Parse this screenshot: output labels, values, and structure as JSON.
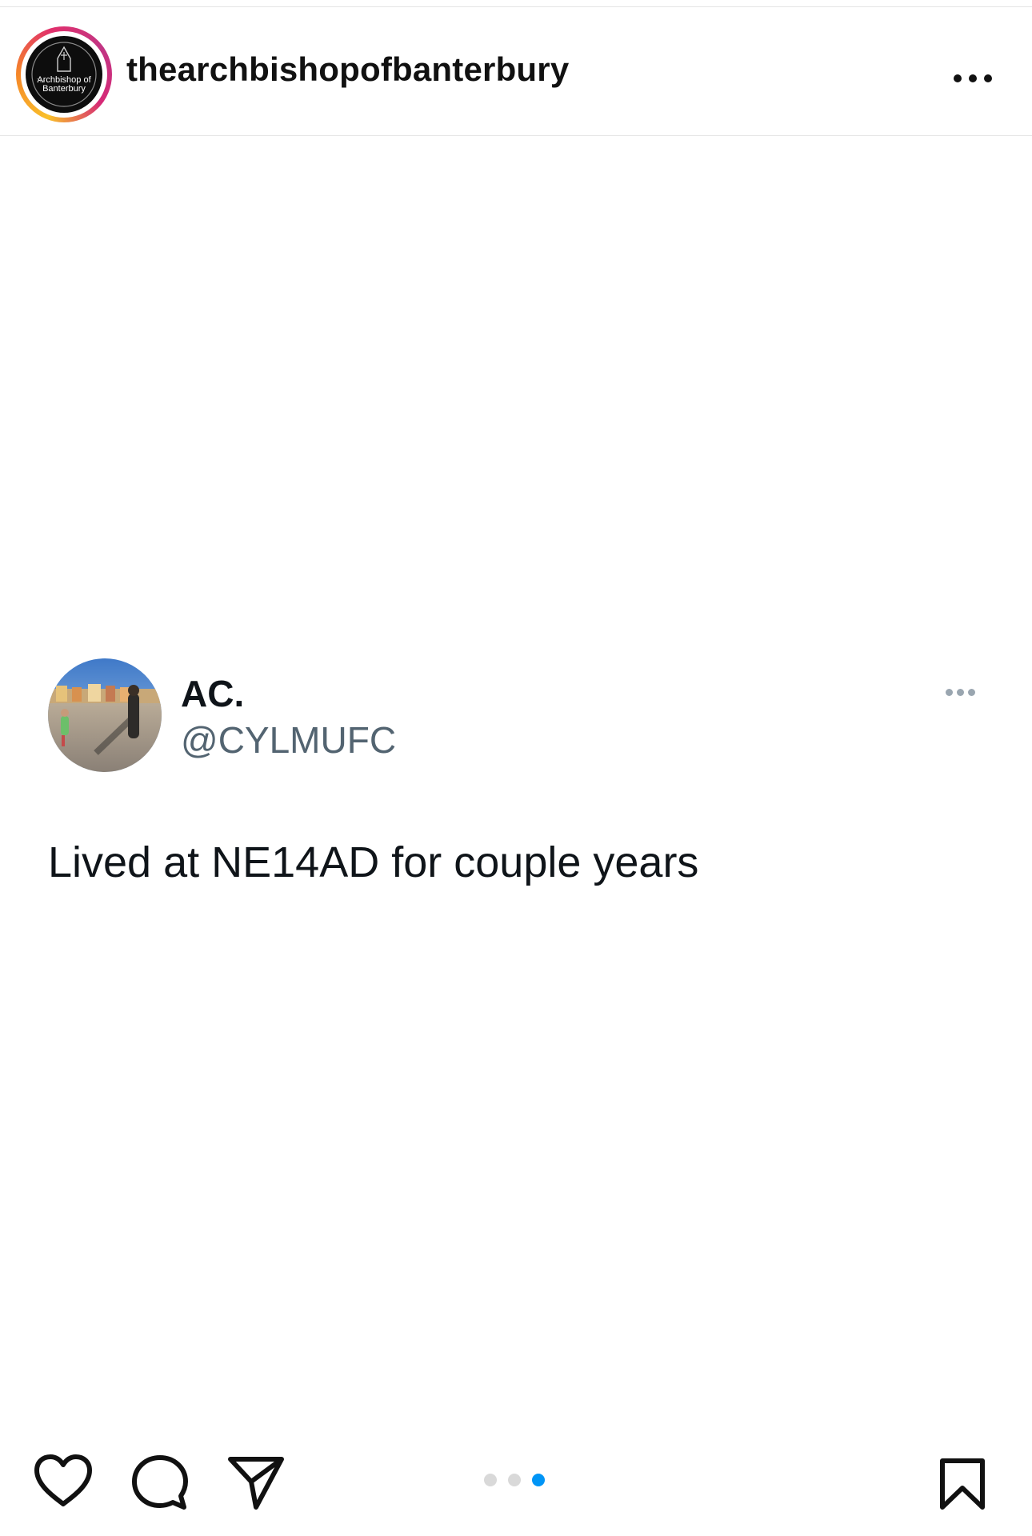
{
  "post": {
    "username": "thearchbishopofbanterbury",
    "avatar_icon": "archbishop-logo-icon",
    "avatar_text": "The Archbishop of Banterbury",
    "more_icon": "more-horizontal-icon"
  },
  "tweet": {
    "display_name": "AC.",
    "handle": "@CYLMUFC",
    "text": "Lived at NE14AD for couple years",
    "avatar_icon": "profile-photo-icon",
    "more_icon": "more-horizontal-icon"
  },
  "actions": {
    "like_icon": "heart-icon",
    "comment_icon": "comment-icon",
    "share_icon": "send-icon",
    "save_icon": "bookmark-icon"
  },
  "carousel": {
    "total": 3,
    "current": 3,
    "active_color": "#0095f6",
    "inactive_color": "#d9d9d9"
  }
}
